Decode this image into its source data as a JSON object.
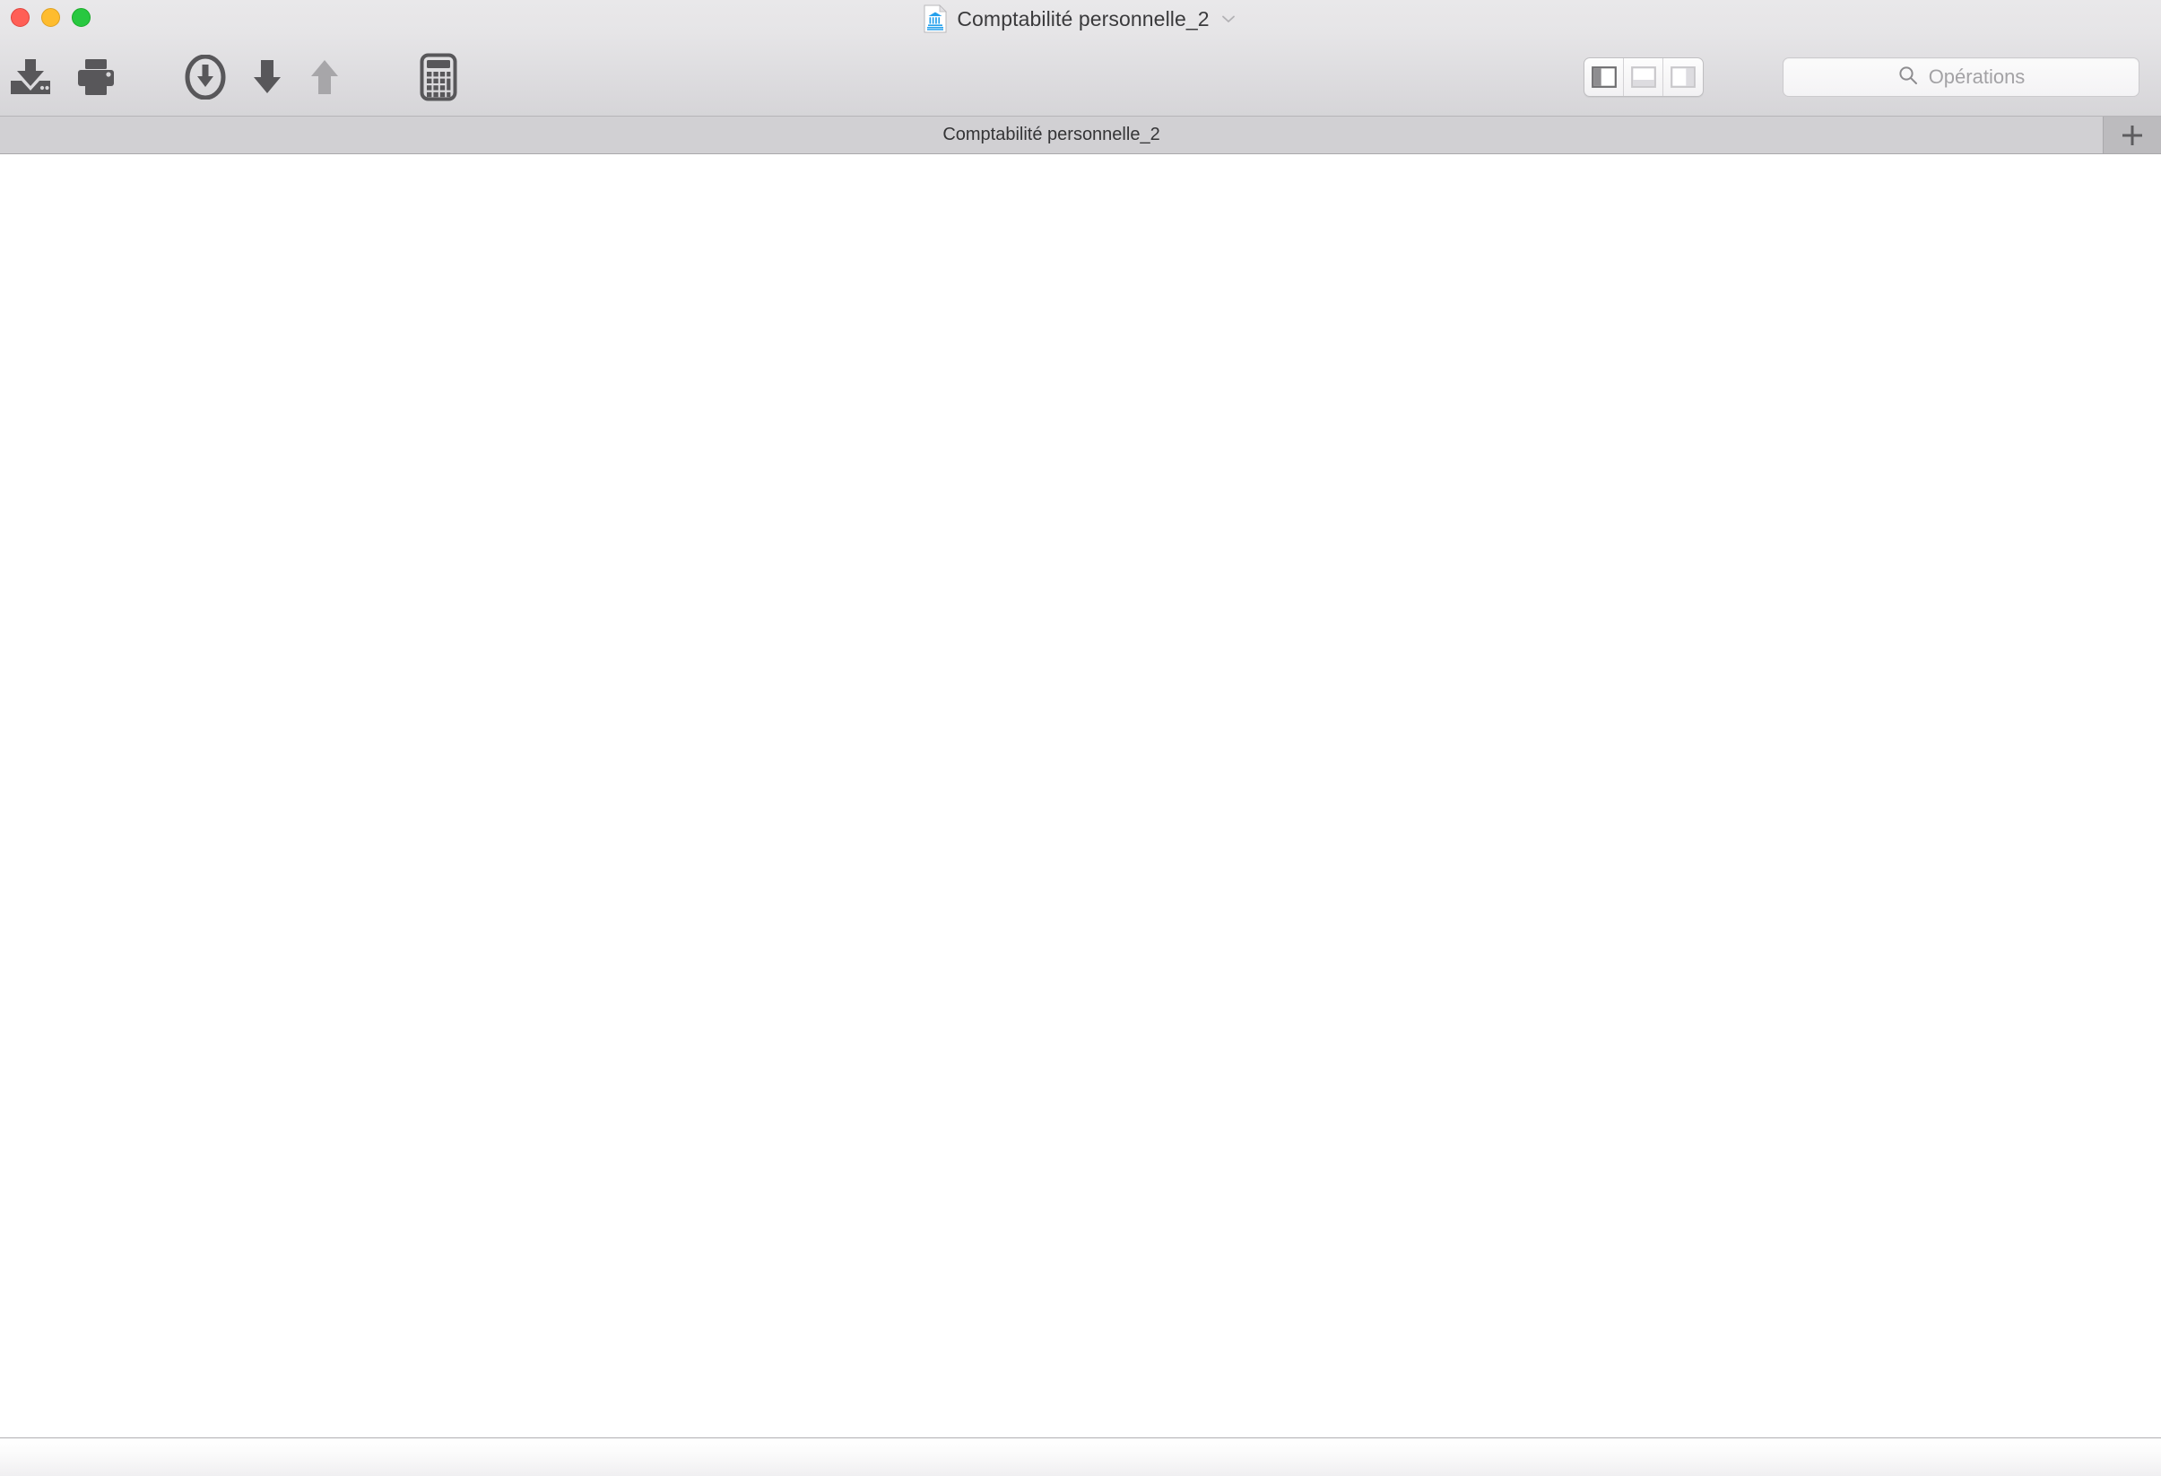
{
  "window": {
    "title": "Comptabilité personnelle_2",
    "document_icon": "bank-document-icon",
    "title_menu_icon": "chevron-down-icon",
    "traffic_lights": {
      "close_label": "Close",
      "minimize_label": "Minimize",
      "maximize_label": "Maximize",
      "close_color": "#ff5f56",
      "minimize_color": "#febc2e",
      "maximize_color": "#28c840"
    }
  },
  "toolbar": {
    "buttons": [
      {
        "name": "save-import-button",
        "icon": "save-down-into-tray-icon",
        "label": "Enregistrer",
        "enabled": true
      },
      {
        "name": "print-button",
        "icon": "printer-icon",
        "label": "Imprimer",
        "enabled": true
      },
      {
        "name": "download-circle-button",
        "icon": "arrow-down-circle-icon",
        "label": "Télécharger",
        "enabled": true
      },
      {
        "name": "move-down-button",
        "icon": "arrow-down-icon",
        "label": "Descendre",
        "enabled": true
      },
      {
        "name": "move-up-button",
        "icon": "arrow-up-icon",
        "label": "Monter",
        "enabled": false
      },
      {
        "name": "calculator-button",
        "icon": "calculator-icon",
        "label": "Calculatrice",
        "enabled": true
      }
    ],
    "view_segments": [
      {
        "name": "view-left-sidebar",
        "icon": "sidebar-left-icon",
        "selected": true
      },
      {
        "name": "view-bottom-panel",
        "icon": "panel-bottom-icon",
        "selected": false
      },
      {
        "name": "view-right-sidebar",
        "icon": "sidebar-right-icon",
        "selected": false
      }
    ],
    "search": {
      "icon": "search-icon",
      "placeholder": "Opérations",
      "value": ""
    }
  },
  "tabbar": {
    "tabs": [
      {
        "label": "Comptabilité personnelle_2",
        "active": true
      }
    ],
    "add_tab_icon": "plus-icon",
    "add_tab_label": "Nouvel onglet"
  },
  "content": {
    "body_text": ""
  },
  "statusbar": {
    "text": ""
  },
  "colors": {
    "toolbar_top": "#e9e8ea",
    "toolbar_bottom": "#d6d5d8",
    "tabbar_bg": "#d1d0d3",
    "tab_add_bg": "#bcbbbe",
    "content_bg": "#ffffff",
    "icon_dark": "#58575a",
    "icon_disabled": "#a7a6a9",
    "title_text": "#3a3a3c",
    "doc_icon_blue": "#24a0ec"
  }
}
